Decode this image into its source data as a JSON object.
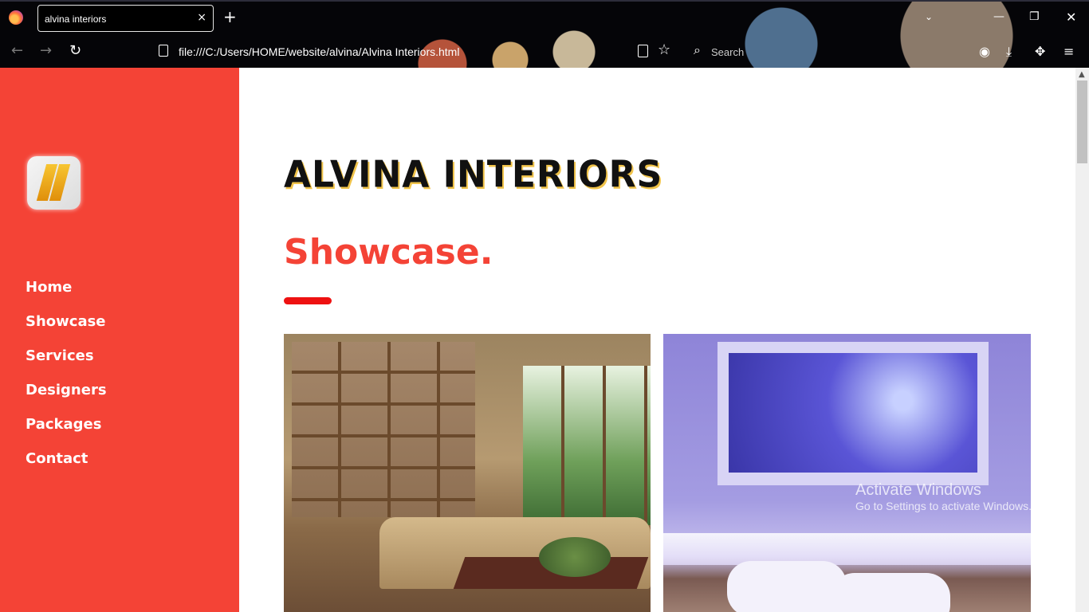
{
  "browser": {
    "tab_title": "alvina interiors",
    "tab_close": "×",
    "new_tab": "+",
    "url": "file:///C:/Users/HOME/website/alvina/Alvina Interiors.html",
    "search_placeholder": "Search",
    "back": "←",
    "forward": "→",
    "reload": "↻",
    "star": "☆",
    "search_glyph": "⌕",
    "list_all_tabs": "⌄",
    "minimize": "—",
    "maximize": "❐",
    "close": "✕",
    "account_glyph": "◉",
    "download_glyph": "⤓",
    "extensions_glyph": "✥",
    "menu_glyph": "≡"
  },
  "sidebar": {
    "accent_color": "#f44336",
    "logo_icon": "folded-gold-bars-logo",
    "items": [
      {
        "label": "Home"
      },
      {
        "label": "Showcase"
      },
      {
        "label": "Services"
      },
      {
        "label": "Designers"
      },
      {
        "label": "Packages"
      },
      {
        "label": "Contact"
      }
    ]
  },
  "main": {
    "brand": "ALVINA INTERIORS",
    "section_title": "Showcase.",
    "underline_color": "#ee1111"
  },
  "watermark": {
    "title": "Activate Windows",
    "subtitle": "Go to Settings to activate Windows."
  },
  "scrollbar": {
    "up_arrow": "▲"
  }
}
